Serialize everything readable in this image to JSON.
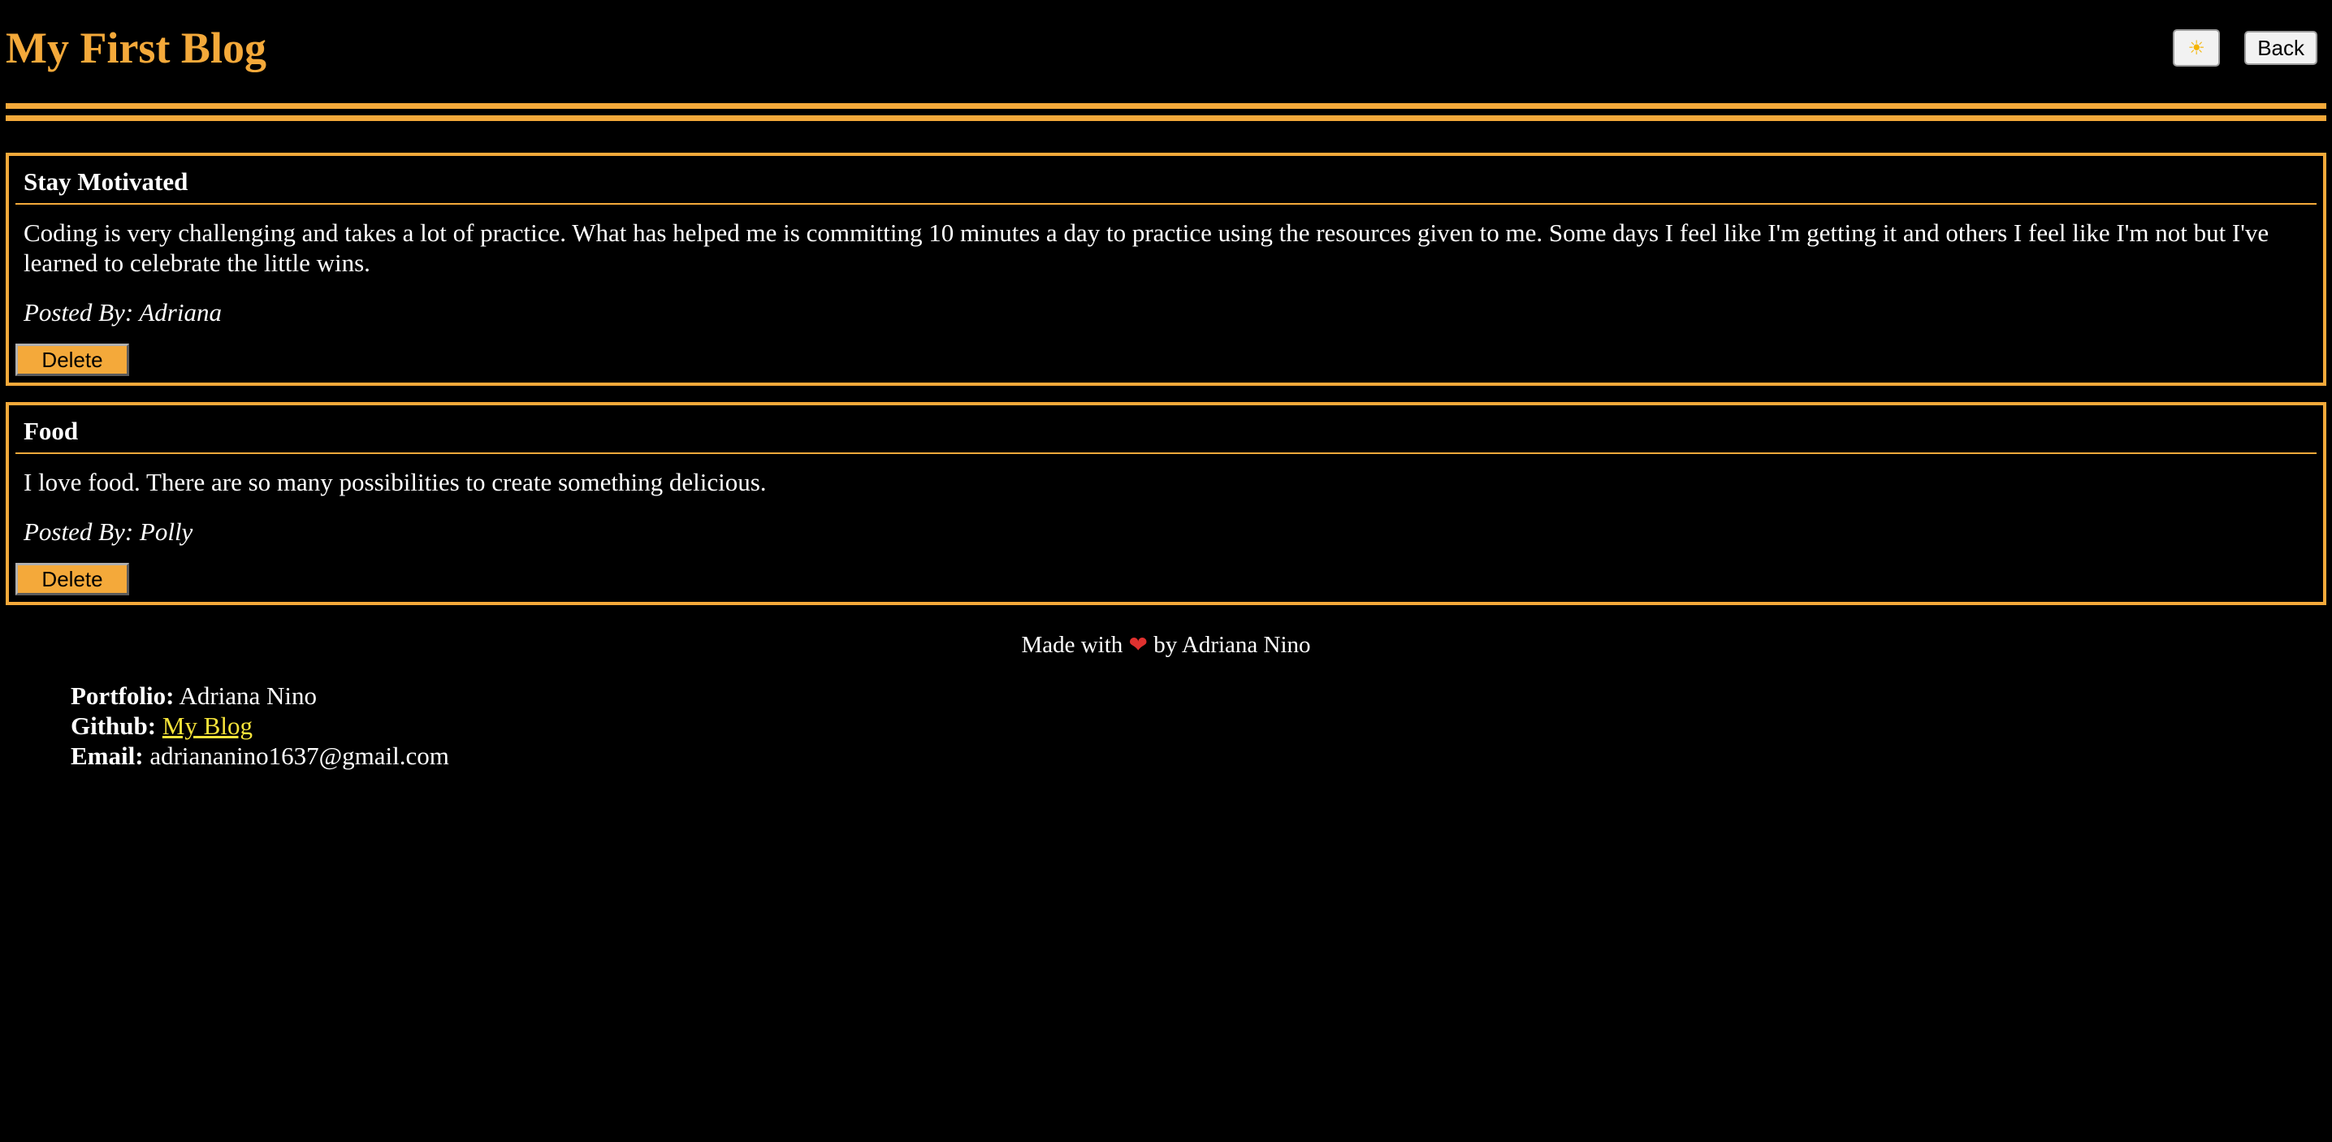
{
  "header": {
    "title": "My First Blog",
    "theme_button_glyph": "☀",
    "theme_icon": "sun-icon",
    "back_label": "Back"
  },
  "colors": {
    "accent": "#f4a93a",
    "background": "#000000",
    "text": "#ffffff",
    "link": "#f7e43a"
  },
  "posts": [
    {
      "title": "Stay Motivated",
      "content": "Coding is very challenging and takes a lot of practice. What has helped me is committing 10 minutes a day to practice using the resources given to me. Some days I feel like I'm getting it and others I feel like I'm not but I've learned to celebrate the little wins.",
      "author": "Posted By: Adriana",
      "delete_label": "Delete"
    },
    {
      "title": "Food",
      "content": "I love food. There are so many possibilities to create something delicious.",
      "author": "Posted By: Polly",
      "delete_label": "Delete"
    }
  ],
  "footer": {
    "credit_prefix": "Made with",
    "heart_glyph": "❤",
    "credit_suffix": "by Adriana Nino",
    "portfolio_label": "Portfolio:",
    "portfolio_value": "Adriana Nino",
    "github_label": "Github:",
    "github_link_text": "My Blog",
    "email_label": "Email:",
    "email_value": "adriananino1637@gmail.com"
  }
}
